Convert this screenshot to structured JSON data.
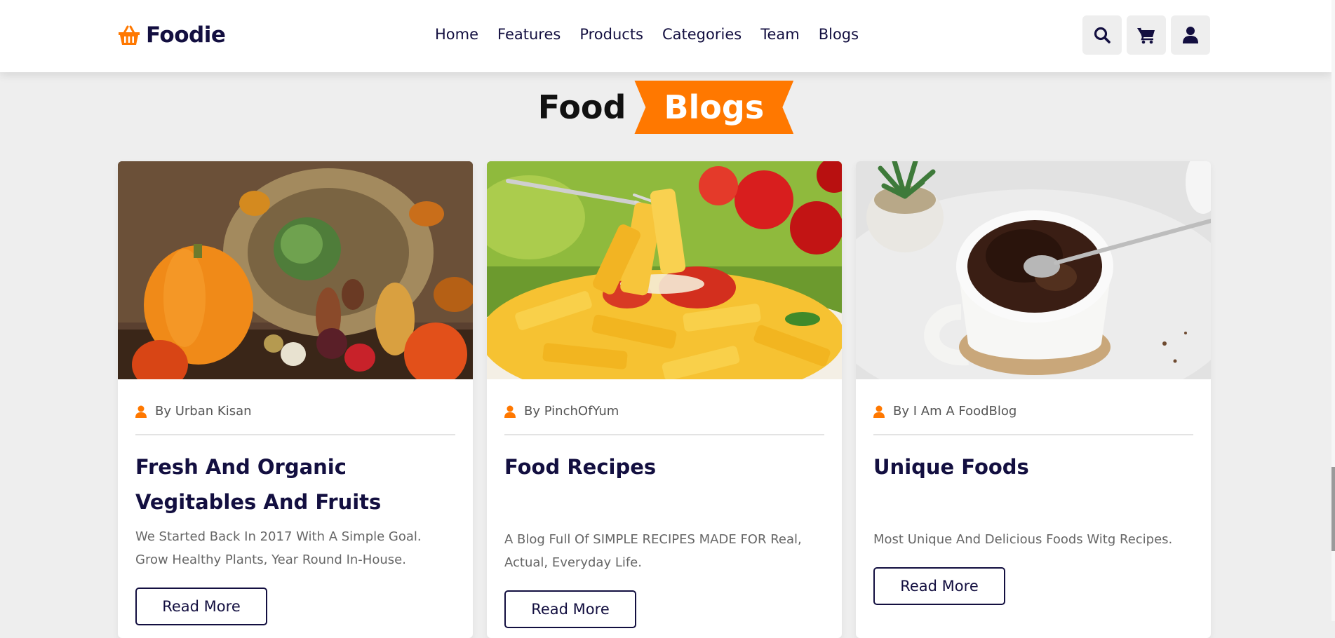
{
  "header": {
    "logo_text": "Foodie",
    "nav": [
      "Home",
      "Features",
      "Products",
      "Categories",
      "Team",
      "Blogs"
    ],
    "icons": [
      "search-icon",
      "cart-icon",
      "user-icon"
    ]
  },
  "section": {
    "heading_main": "Food",
    "heading_accent": "Blogs"
  },
  "blogs": [
    {
      "image": "vegetables-basket-image",
      "author": "By Urban Kisan",
      "title": "Fresh And Organic Vegitables And Fruits",
      "text": "We Started Back In 2017 With A Simple Goal. Grow Healthy Plants, Year Round In-House.",
      "button": "Read More"
    },
    {
      "image": "penne-pasta-image",
      "author": "By PinchOfYum",
      "title": "Food Recipes",
      "text": "A Blog Full Of SIMPLE RECIPES MADE FOR Real, Actual, Everyday Life.",
      "button": "Read More"
    },
    {
      "image": "chocolate-mug-cake-image",
      "author": "By I Am A FoodBlog",
      "title": "Unique Foods",
      "text": "Most Unique And Delicious Foods Witg Recipes.",
      "button": "Read More"
    }
  ],
  "colors": {
    "accent": "#ff7800",
    "text_dark": "#130f40",
    "background": "#eeeeee"
  }
}
